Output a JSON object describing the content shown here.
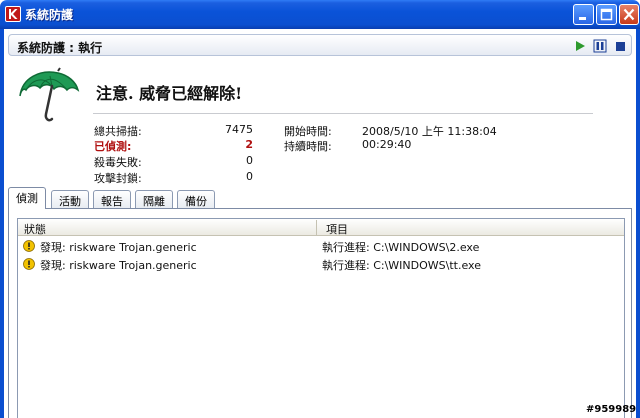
{
  "window": {
    "title": "系統防護"
  },
  "section": {
    "title": "系統防護 : 執行"
  },
  "status": {
    "headline": "注意. 威脅已經解除!"
  },
  "stats": {
    "total_scanned_label": "總共掃描:",
    "total_scanned_value": "7475",
    "detected_label": "已偵測:",
    "detected_value": "2",
    "disinfect_failed_label": "殺毒失敗:",
    "disinfect_failed_value": "0",
    "attacks_blocked_label": "攻擊封鎖:",
    "attacks_blocked_value": "0",
    "start_time_label": "開始時間:",
    "start_time_value": "2008/5/10 上午 11:38:04",
    "duration_label": "持續時間:",
    "duration_value": "00:29:40"
  },
  "tabs": [
    {
      "label": "偵測",
      "active": true
    },
    {
      "label": "活動",
      "active": false
    },
    {
      "label": "報告",
      "active": false
    },
    {
      "label": "隔離",
      "active": false
    },
    {
      "label": "備份",
      "active": false
    }
  ],
  "table": {
    "columns": [
      "狀態",
      "項目"
    ],
    "rows": [
      {
        "status": "發現: riskware Trojan.generic",
        "item": "執行進程: C:\\WINDOWS\\2.exe"
      },
      {
        "status": "發現: riskware Trojan.generic",
        "item": "執行進程: C:\\WINDOWS\\tt.exe"
      }
    ]
  },
  "watermark": "#959989",
  "colors": {
    "titlebar": "#0a53d8",
    "alert_red": "#b01010",
    "umbrella_green": "#1f9a55",
    "warning_yellow": "#f2c200"
  }
}
